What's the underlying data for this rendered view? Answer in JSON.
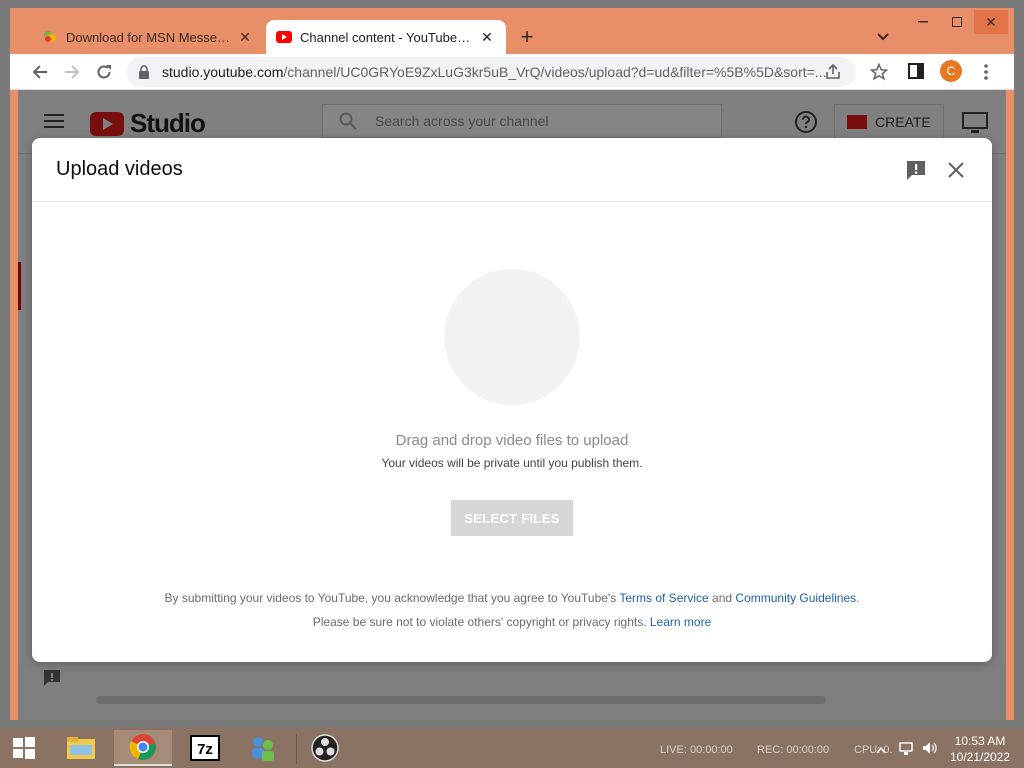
{
  "browser": {
    "tabs": [
      {
        "title": "Download for MSN Messenger | ",
        "favicon": "msn-favicon"
      },
      {
        "title": "Channel content - YouTube Studio",
        "favicon": "youtube-favicon"
      }
    ],
    "url_host": "studio.youtube.com",
    "url_path": "/channel/UC0GRYoE9ZxLuG3kr5uB_VrQ/videos/upload?d=ud&filter=%5B%5D&sort=...",
    "profile_initial": "C",
    "accent_color": "#e88e68"
  },
  "studio": {
    "logo_text": "Studio",
    "search_placeholder": "Search across your channel",
    "create_label": "CREATE"
  },
  "dialog": {
    "title": "Upload videos",
    "drop_heading": "Drag and drop video files to upload",
    "private_note": "Your videos will be private until you publish them.",
    "select_files_label": "SELECT FILES",
    "tos_prefix": "By submitting your videos to YouTube, you acknowledge that you agree to YouTube's ",
    "tos_link": "Terms of Service",
    "tos_and": " and ",
    "guidelines_link": "Community Guidelines",
    "tos_suffix": ".",
    "copyright_text": "Please be sure not to violate others' copyright or privacy rights. ",
    "learn_more_link": "Learn more",
    "link_color": "#1f5fa8"
  },
  "taskbar": {
    "obs_live": "LIVE: 00:00:00",
    "obs_rec": "REC: 00:00:00",
    "obs_cpu": "CPU: 0.",
    "time": "10:53 AM",
    "date": "10/21/2022"
  }
}
